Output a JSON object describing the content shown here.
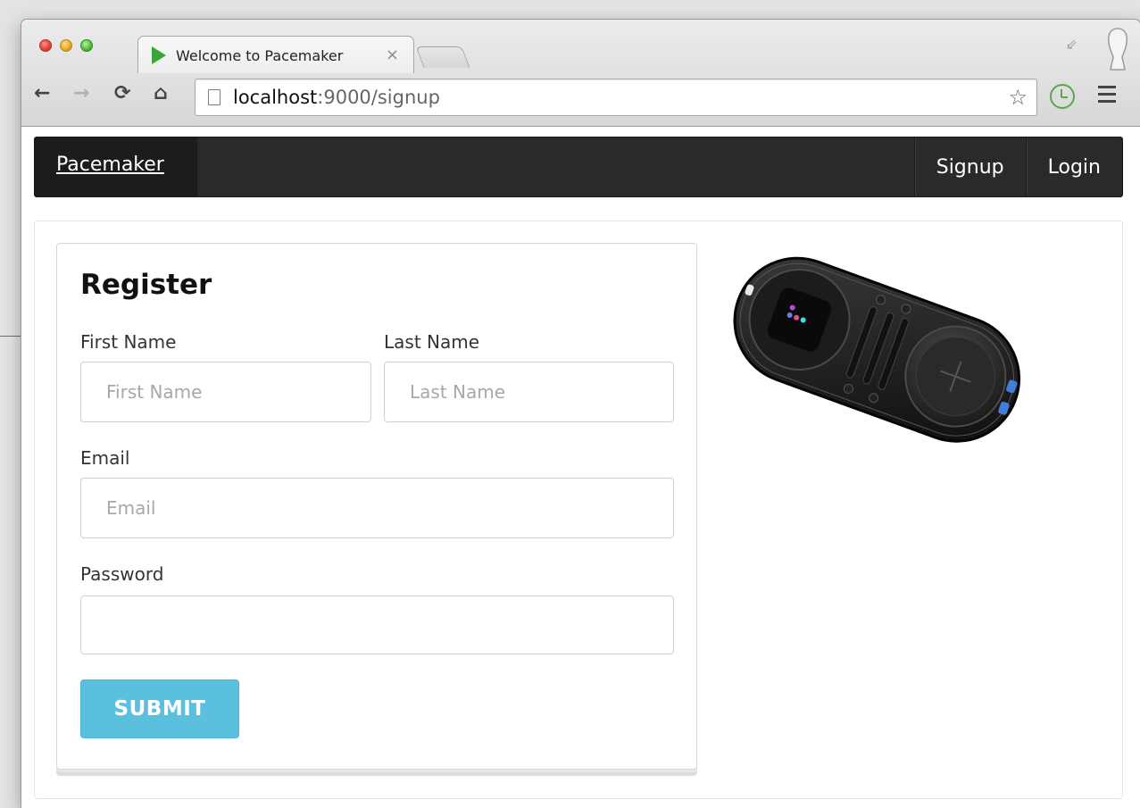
{
  "browser": {
    "tab_title": "Welcome to Pacemaker",
    "tab_close": "×",
    "url_host": "localhost",
    "url_rest": ":9000/signup"
  },
  "navbar": {
    "brand": "Pacemaker",
    "links": [
      {
        "label": "Signup"
      },
      {
        "label": "Login"
      }
    ]
  },
  "form": {
    "title": "Register",
    "first_name": {
      "label": "First Name",
      "placeholder": "First Name",
      "value": ""
    },
    "last_name": {
      "label": "Last Name",
      "placeholder": "Last Name",
      "value": ""
    },
    "email": {
      "label": "Email",
      "placeholder": "Email",
      "value": ""
    },
    "password": {
      "label": "Password",
      "placeholder": "",
      "value": ""
    },
    "submit_label": "SUBMIT"
  },
  "colors": {
    "navbar_bg": "#2a2a2a",
    "submit_bg": "#5bc0de"
  },
  "icons": [
    "back-icon",
    "forward-icon",
    "reload-icon",
    "home-icon",
    "page-icon",
    "star-icon",
    "history-clock-icon",
    "menu-icon",
    "restore-icon",
    "profile-icon",
    "favicon-play-icon"
  ]
}
